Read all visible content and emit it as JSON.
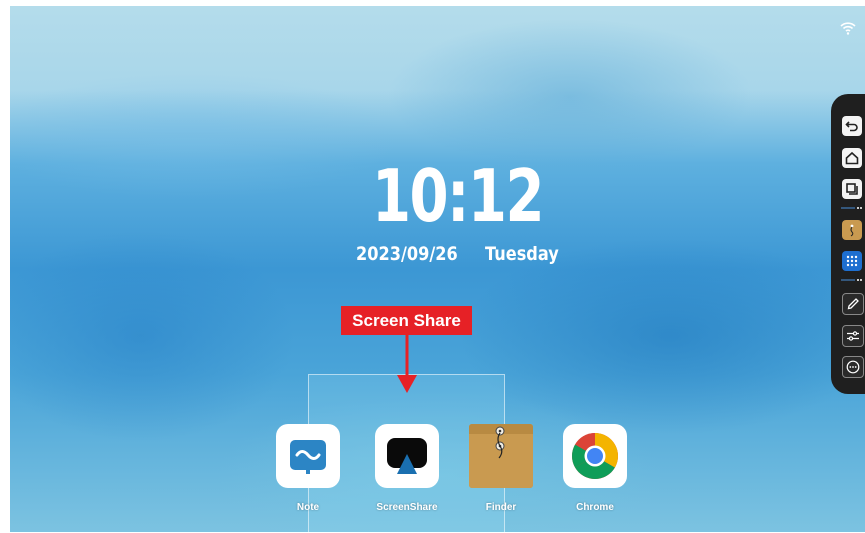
{
  "clock": {
    "time": "10:12",
    "date": "2023/09/26",
    "day": "Tuesday"
  },
  "callout": {
    "label": "Screen Share",
    "color": "#e62126"
  },
  "apps": [
    {
      "name": "Note",
      "icon": "note-icon"
    },
    {
      "name": "ScreenShare",
      "icon": "screenshare-icon"
    },
    {
      "name": "Finder",
      "icon": "finder-icon"
    },
    {
      "name": "Chrome",
      "icon": "chrome-icon"
    }
  ],
  "sidebar": {
    "buttons": [
      "back-icon",
      "home-icon",
      "windows-icon",
      "finder-icon",
      "apps-grid-icon",
      "pen-icon",
      "settings-sliders-icon",
      "more-icon"
    ]
  },
  "status": {
    "wifi": "wifi-icon"
  }
}
